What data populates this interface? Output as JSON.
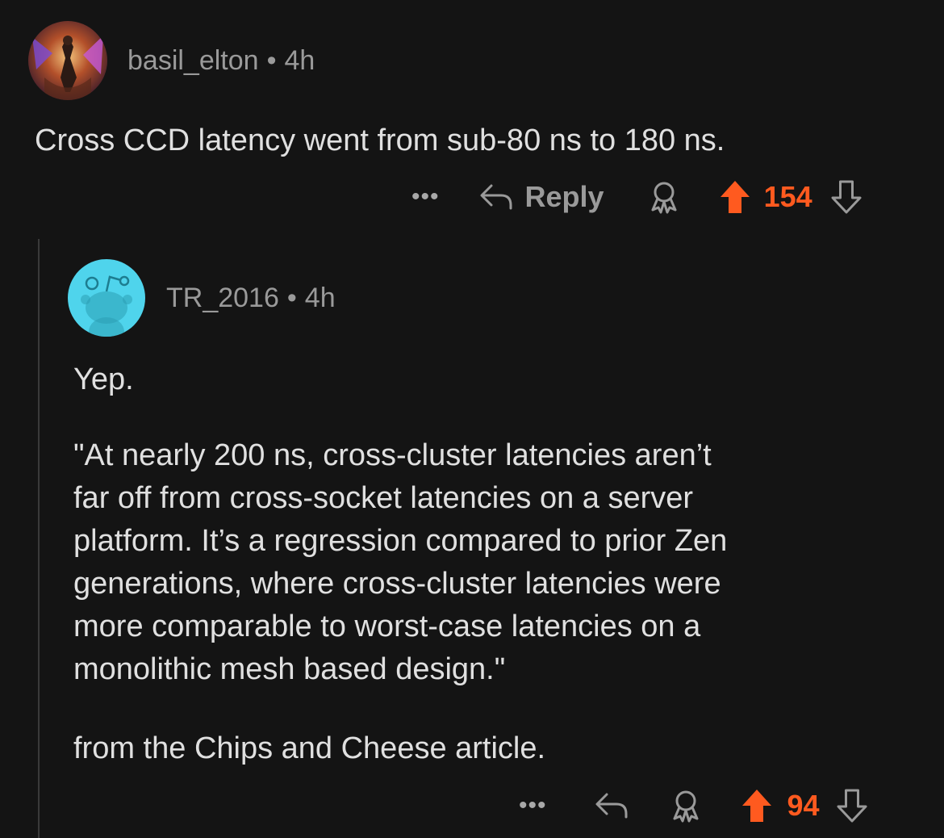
{
  "comments": [
    {
      "username": "basil_elton",
      "separator": "•",
      "age": "4h",
      "body": "Cross CCD latency went from sub-80 ns to 180 ns.",
      "actions": {
        "more_label": "•••",
        "reply_label": "Reply",
        "score": "154",
        "upvoted": true
      },
      "avatar_icon": "user-avatar-icon"
    },
    {
      "username": "TR_2016",
      "separator": "•",
      "age": "4h",
      "paragraphs": [
        "Yep.",
        [
          "\"At nearly 200 ns, cross-cluster latencies aren’t",
          "far off from cross-socket latencies on a server",
          "platform. It’s a regression compared to prior Zen",
          "generations, where cross-cluster latencies were",
          "more comparable to worst-case latencies on a",
          "monolithic mesh based design.\""
        ],
        "from the Chips and Cheese article."
      ],
      "actions": {
        "more_label": "•••",
        "score": "94",
        "upvoted": true
      },
      "avatar_icon": "snoo-avatar-icon"
    }
  ],
  "colors": {
    "background": "#141414",
    "upvote": "#ff5a1f",
    "muted": "#9a9a9a",
    "text": "#e0e0e0",
    "avatar_bg": "#4fd4ec"
  }
}
